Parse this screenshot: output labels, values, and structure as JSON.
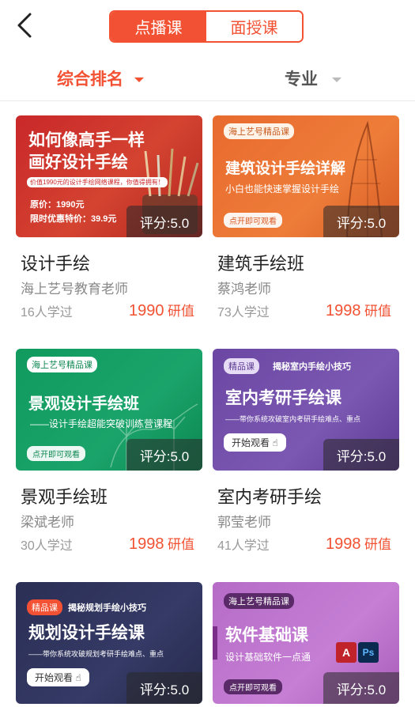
{
  "header": {
    "tabs": [
      {
        "label": "点播课",
        "active": true
      },
      {
        "label": "面授课",
        "active": false
      }
    ]
  },
  "filters": {
    "sort_label": "综合排名",
    "major_label": "专业"
  },
  "colors": {
    "accent": "#f25233"
  },
  "courses": [
    {
      "title": "设计手绘",
      "teacher": "海上艺号教育老师",
      "learners": "16人学过",
      "price": "1990",
      "price_unit": "研值",
      "score": "评分:5.0",
      "thumb": {
        "heading_line1": "如何像高手一样",
        "heading_line2": "画好设计手绘",
        "banner": "价值1990元的设计手绘网络课程，你值得拥有！",
        "original_price": "原价：1990元",
        "promo_price": "限时优惠特价：39.9元"
      }
    },
    {
      "title": "建筑手绘班",
      "teacher": "蔡鸿老师",
      "learners": "73人学过",
      "price": "1998",
      "price_unit": "研值",
      "score": "评分:5.0",
      "thumb": {
        "tag": "海上艺号精品课",
        "heading": "建筑设计手绘详解",
        "subtitle": "小白也能快速掌握设计手绘",
        "pill": "点开即可观看"
      }
    },
    {
      "title": "景观手绘班",
      "teacher": "梁斌老师",
      "learners": "30人学过",
      "price": "1998",
      "price_unit": "研值",
      "score": "评分:5.0",
      "thumb": {
        "tag": "海上艺号精品课",
        "heading": "景观设计手绘班",
        "subtitle": "——设计手绘超能突破训练营课程",
        "pill": "点开即可观看"
      }
    },
    {
      "title": "室内考研手绘",
      "teacher": "郭莹老师",
      "learners": "41人学过",
      "price": "1998",
      "price_unit": "研值",
      "score": "评分:5.0",
      "thumb": {
        "tag": "精品课",
        "tagline": "揭秘室内手绘小技巧",
        "heading": "室内考研手绘课",
        "subtitle": "——带你系统攻破室内考研手绘难点、重点",
        "pill": "开始观看"
      }
    },
    {
      "score": "评分:5.0",
      "thumb": {
        "tag": "精品课",
        "tagline": "揭秘规划手绘小技巧",
        "heading": "规划设计手绘课",
        "subtitle": "——带你系统攻破规划考研手绘难点、重点",
        "pill": "开始观看"
      }
    },
    {
      "score": "评分:5.0",
      "thumb": {
        "tag": "海上艺号精品课",
        "heading": "软件基础课",
        "subtitle": "设计基础软件一点通",
        "pill": "点开即可观看"
      }
    }
  ]
}
